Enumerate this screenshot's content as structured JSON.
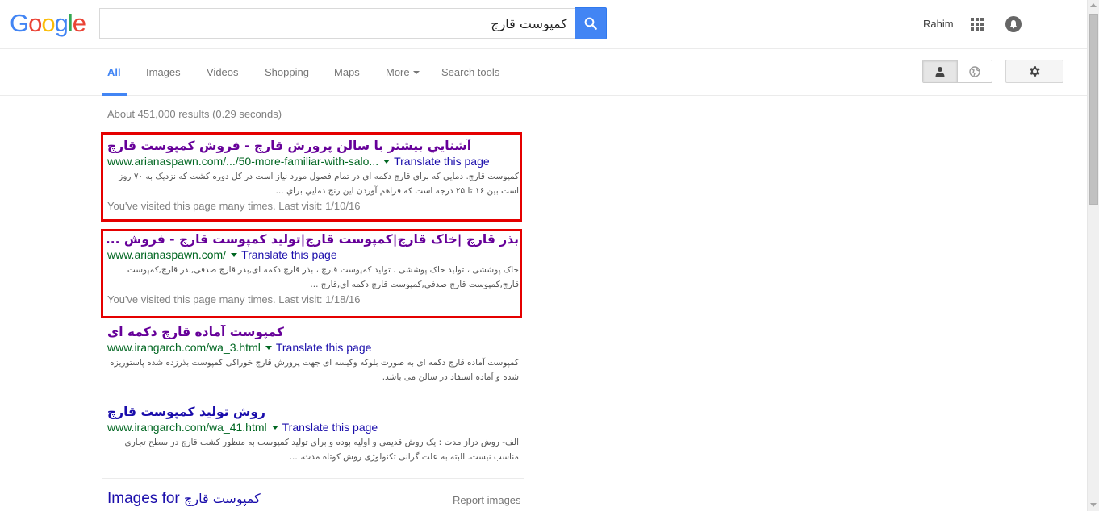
{
  "logo": {
    "letters": [
      "G",
      "o",
      "o",
      "g",
      "l",
      "e"
    ],
    "colors": [
      "#4285f4",
      "#ea4335",
      "#fbbc05",
      "#4285f4",
      "#34a853",
      "#ea4335"
    ]
  },
  "search": {
    "query": "کمپوست قارچ",
    "button_icon": "search-icon"
  },
  "account": {
    "name": "Rahim",
    "apps_icon": "apps-grid-icon",
    "notifications_icon": "notifications-bell-icon"
  },
  "nav": {
    "tabs": [
      {
        "label": "All"
      },
      {
        "label": "Images"
      },
      {
        "label": "Videos"
      },
      {
        "label": "Shopping"
      },
      {
        "label": "Maps"
      },
      {
        "label": "More"
      },
      {
        "label": "Search tools"
      }
    ],
    "active_tab": "All",
    "personal_icon": "person-icon",
    "global_icon": "globe-icon",
    "settings_icon": "gear-icon"
  },
  "stats": "About 451,000 results (0.29 seconds)",
  "results": [
    {
      "title": "آشنايي بيشتر با سالن پرورش قارچ - فروش كمپوست قارچ",
      "url": "www.arianaspawn.com/.../50-more-familiar-with-salo...",
      "translate": "Translate this page",
      "snippet": "کمپوست قارچ. دمايي که براي قارچ دکمه اي در تمام فصول مورد نياز است در کل دوره کشت که نزديک به ۷۰ روز است بين ۱۶ تا ۲۵ درجه است که فراهم آوردن اين رنج دمايي براي ...",
      "visited": "You've visited this page many times. Last visit: 1/10/16"
    },
    {
      "title": "بذر قارچ |خاک قارچ|کمپوست قارچ|تولید کمپوست قارچ - فروش ...",
      "url": "www.arianaspawn.com/",
      "translate": "Translate this page",
      "snippet": "خاک پوششی ، تولید خاک پوششی ، تولید کمپوست قارچ ، بذر قارچ دکمه ای,بذر قارچ صدفی,بذر قارچ,کمپوست قارچ,کمپوست قارچ صدفی,کمپوست قارچ دکمه ای,قارچ ...",
      "visited": "You've visited this page many times. Last visit: 1/18/16"
    },
    {
      "title": "کمپوست آماده قارچ دکمه ای",
      "url": "www.irangarch.com/wa_3.html",
      "translate": "Translate this page",
      "snippet": "کمپوست آماده قارچ دکمه ای به صورت بلوکه وکیسه ای جهت پرورش قارچ خوراکی کمپوست بذرزده شده پاستوریزه شده و آماده استفاد در سالن می باشد."
    },
    {
      "title": "روش تولید کمپوست قارچ",
      "url": "www.irangarch.com/wa_41.html",
      "translate": "Translate this page",
      "snippet": "الف- روش دراز مدت : یک روش قدیمی و اولیه بوده و برای تولید کمپوست به منظور کشت قارچ در سطح تجاری مناسب نیست. البته به علت گرانی تکنولوژی روش کوتاه مدت، ..."
    }
  ],
  "images_for": {
    "prefix": "Images for",
    "query": "کمپوست قارچ"
  },
  "report_images": "Report images",
  "colors": {
    "highlight_box": "#e50000",
    "link": "#1a0dab",
    "visited_link": "#660099",
    "url": "#006621",
    "accent": "#4285f4"
  }
}
